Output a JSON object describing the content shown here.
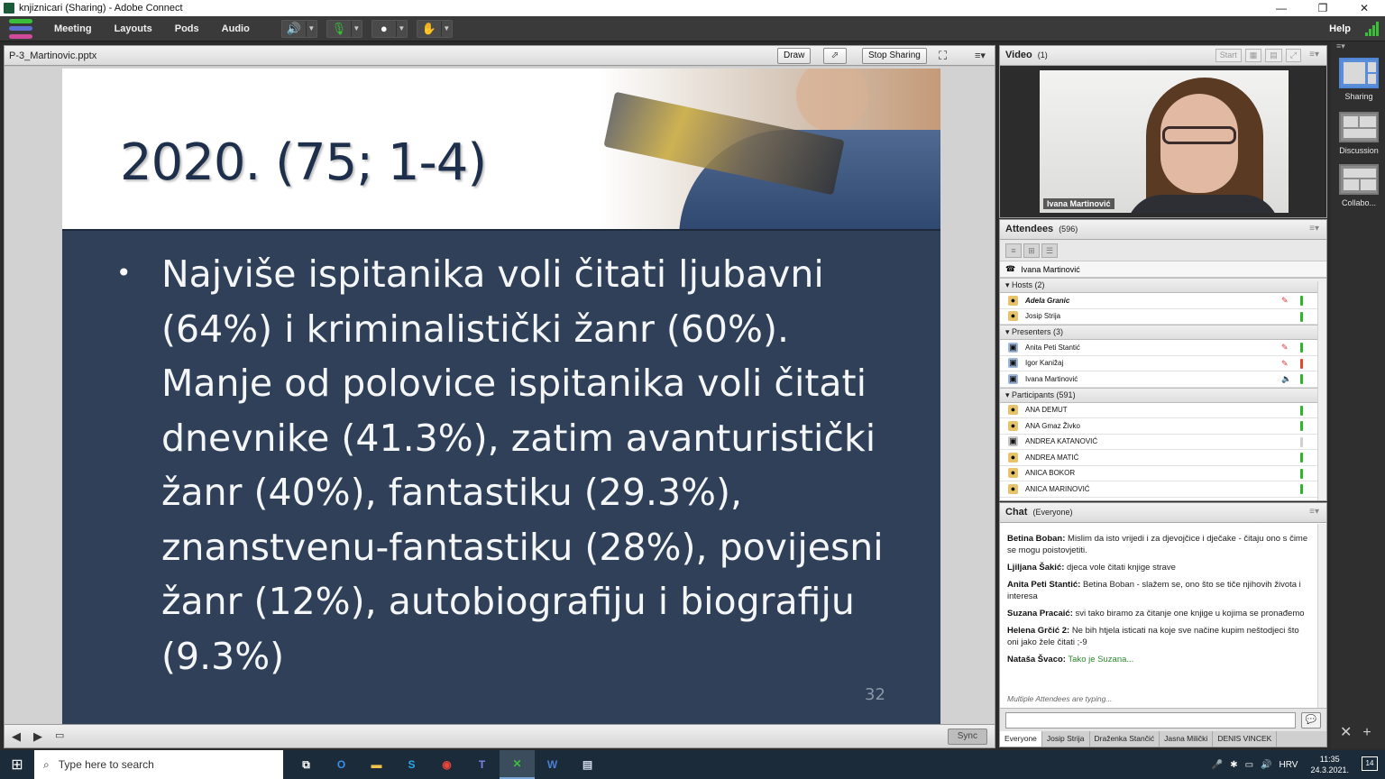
{
  "window": {
    "title": "knjiznicari (Sharing) - Adobe Connect",
    "controls": [
      "—",
      "❐",
      "✕"
    ]
  },
  "menubar": {
    "items": [
      "Meeting",
      "Layouts",
      "Pods",
      "Audio"
    ],
    "help": "Help"
  },
  "share_pod": {
    "filename": "P-3_Martinovic.pptx",
    "draw_label": "Draw",
    "stop_sharing_label": "Stop Sharing",
    "sync_label": "Sync"
  },
  "slide": {
    "title": "2020. (75; 1-4)",
    "bullet": "•",
    "body": "Najviše ispitanika voli čitati ljubavni (64%) i kriminalistički žanr (60%). Manje od polovice ispitanika voli čitati dnevnike (41.3%), zatim avanturistički žanr (40%), fantastiku (29.3%), znanstvenu-fantastiku (28%), povijesni žanr (12%), autobiografiju i biografiju (9.3%)",
    "page_number": "32"
  },
  "video_pod": {
    "title": "Video",
    "count": "(1)",
    "start_label": "Start",
    "presenter_name": "Ivana Martinović"
  },
  "attendees_pod": {
    "title": "Attendees",
    "count": "(596)",
    "me": "Ivana Martinović",
    "groups": [
      {
        "label": "Hosts (2)",
        "people": [
          {
            "name": "Adela Granic",
            "status": "green",
            "muted": true,
            "italic": true
          },
          {
            "name": "Josip Strija",
            "status": "green",
            "muted": false,
            "italic": false
          }
        ]
      },
      {
        "label": "Presenters (3)",
        "people": [
          {
            "name": "Anita Peti Stantić",
            "status": "green",
            "muted": true,
            "italic": false
          },
          {
            "name": "Igor Kanižaj",
            "status": "red",
            "muted": true,
            "italic": false
          },
          {
            "name": "Ivana Martinović",
            "status": "green",
            "muted": false,
            "speaking": true,
            "italic": false
          }
        ]
      },
      {
        "label": "Participants (591)",
        "people": [
          {
            "name": "ANA DEMUT",
            "status": "green"
          },
          {
            "name": "ANA Gmaz Živko",
            "status": "green"
          },
          {
            "name": "ANDREA KATANOVIĆ",
            "status": "gray"
          },
          {
            "name": "ANDREA MATIĆ",
            "status": "green"
          },
          {
            "name": "ANICA BOKOR",
            "status": "green"
          },
          {
            "name": "ANICA MARINOVIĆ",
            "status": "green"
          }
        ]
      }
    ]
  },
  "chat_pod": {
    "title": "Chat",
    "scope": "(Everyone)",
    "messages": [
      {
        "author": "Betina Boban:",
        "text": "Mislim da isto vrijedi i za djevojčice i dječake - čitaju ono s čime se mogu poistovjetiti."
      },
      {
        "author": "Ljiljana Šakić:",
        "text": "djeca vole čitati knjige strave"
      },
      {
        "author": "Anita Peti Stantić:",
        "text": "Betina Boban - slažem se, ono što se tiče njihovih života i interesa"
      },
      {
        "author": "Suzana Pracaić:",
        "text": "svi tako biramo za čitanje one knjige u kojima se pronađemo"
      },
      {
        "author": "Helena Grčić 2:",
        "text": "Ne bih htjela isticati na koje sve načine kupim neštodjeci što oni jako žele čitati ;-9"
      },
      {
        "author": "Nataša Švaco:",
        "text": "Tako je Suzana..."
      }
    ],
    "typing_status": "Multiple Attendees are typing...",
    "input_value": "",
    "tabs": [
      "Everyone",
      "Josip Strija",
      "Draženka Stančić",
      "Jasna Milički",
      "DENIS VINCEK"
    ]
  },
  "layouts": [
    {
      "label": "Sharing",
      "active": true
    },
    {
      "label": "Discussion",
      "active": false
    },
    {
      "label": "Collabo...",
      "active": false
    }
  ],
  "taskbar": {
    "search_placeholder": "Type here to search",
    "language": "HRV",
    "time": "11:35",
    "date": "24.3.2021.",
    "notifications": "14"
  },
  "colors": {
    "slide_bg": "#2f4058",
    "slide_title": "#1e2f4c",
    "chrome_dark": "#3a3a3a",
    "status_green": "#2db52d",
    "status_red": "#e04a2a",
    "taskbar": "#1b2b3a"
  }
}
